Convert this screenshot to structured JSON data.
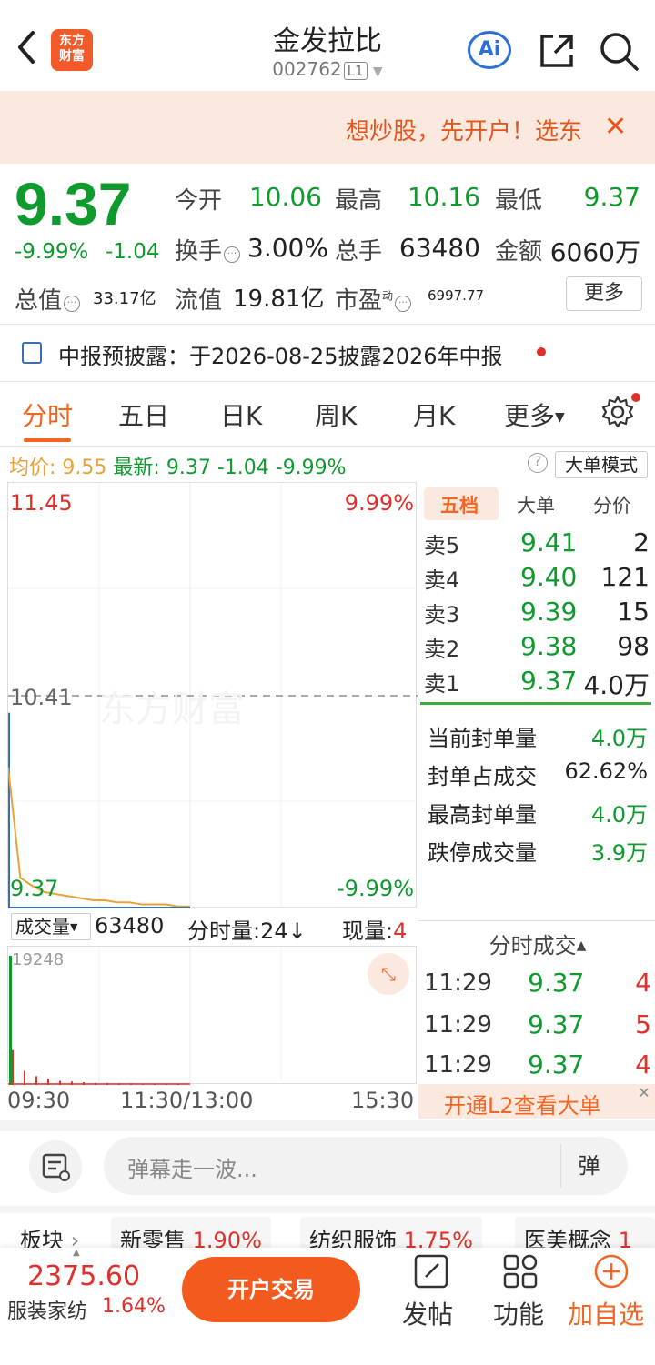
{
  "header": {
    "logo_text_line1": "东方",
    "logo_text_line2": "财富",
    "title": "金发拉比",
    "code": "002762",
    "level": "L1",
    "ai_label": "Ai"
  },
  "banner": {
    "text": "想炒股，先开户！选东"
  },
  "quote": {
    "price": "9.37",
    "pct": "-9.99%",
    "change": "-1.04",
    "fields": {
      "open_label": "今开",
      "open": "10.06",
      "high_label": "最高",
      "high": "10.16",
      "low_label": "最低",
      "low": "9.37",
      "turnover_label": "换手",
      "turnover": "3.00%",
      "volume_label": "总手",
      "volume": "63480",
      "amount_label": "金额",
      "amount": "6060万",
      "mktcap_label": "总值",
      "mktcap": "33.17亿",
      "float_label": "流值",
      "float": "19.81亿",
      "pe_label": "市盈",
      "pe_sup": "动",
      "pe": "6997.77"
    },
    "more_label": "更多"
  },
  "notice": {
    "text": "中报预披露：于2026-08-25披露2026年中报"
  },
  "tabs": [
    "分时",
    "五日",
    "日K",
    "周K",
    "月K",
    "更多"
  ],
  "avg_row": {
    "avg_label": "均价:",
    "avg": "9.55",
    "latest_label": "最新:",
    "latest": "9.37",
    "chg": "-1.04",
    "pct": "-9.99%",
    "help": "?",
    "bigorder_label": "大单模式"
  },
  "chart": {
    "top_price": "11.45",
    "top_pct": "9.99%",
    "mid_price": "10.41",
    "bottom_price": "9.37",
    "bottom_pct": "-9.99%",
    "watermark": "东方财富",
    "vol_max": "19248",
    "line_color": "#e8a23a",
    "up_color": "#e0302b",
    "down_color": "#0f9a2e"
  },
  "chart_data": {
    "type": "line",
    "title": "",
    "ylim": [
      9.37,
      11.45
    ],
    "series": [
      {
        "name": "",
        "values": [
          10.06,
          9.52,
          9.48,
          9.45,
          9.44,
          9.43,
          9.42,
          9.41,
          9.41,
          9.4,
          9.4,
          9.39,
          9.39,
          9.39,
          9.38,
          9.38
        ]
      }
    ],
    "volume": [
      19248,
      5200,
      2100,
      1300,
      900,
      600,
      500,
      400,
      300,
      300,
      250,
      250,
      200,
      200,
      180,
      160
    ]
  },
  "volume_row": {
    "label": "成交量",
    "total": "63480",
    "fen_label": "分时量:24↓",
    "now_label": "现量:",
    "now_value": "4"
  },
  "time_axis": [
    "09:30",
    "11:30/13:00",
    "15:30"
  ],
  "orderbook": {
    "tabs": [
      "五档",
      "大单",
      "分价"
    ],
    "asks": [
      {
        "label": "卖5",
        "price": "9.41",
        "vol": "2"
      },
      {
        "label": "卖4",
        "price": "9.40",
        "vol": "121"
      },
      {
        "label": "卖3",
        "price": "9.39",
        "vol": "15"
      },
      {
        "label": "卖2",
        "price": "9.38",
        "vol": "98"
      },
      {
        "label": "卖1",
        "price": "9.37",
        "vol": "4.0万"
      }
    ],
    "seal": [
      {
        "label": "当前封单量",
        "value": "4.0万"
      },
      {
        "label": "封单占成交",
        "value": "62.62%"
      },
      {
        "label": "最高封单量",
        "value": "4.0万"
      },
      {
        "label": "跌停成交量",
        "value": "3.9万"
      }
    ],
    "ticks_title": "分时成交",
    "ticks": [
      {
        "time": "11:29",
        "price": "9.37",
        "vol": "4"
      },
      {
        "time": "11:29",
        "price": "9.37",
        "vol": "5"
      },
      {
        "time": "11:29",
        "price": "9.37",
        "vol": "4"
      }
    ],
    "l2_text": "开通L2查看大单"
  },
  "danmu": {
    "placeholder": "弹幕走一波...",
    "btn": "弹"
  },
  "sectors": {
    "label": "板块",
    "items": [
      {
        "name": "新零售",
        "pct": "1.90%"
      },
      {
        "name": "纺织服饰",
        "pct": "1.75%"
      },
      {
        "name": "医美概念",
        "pct": "1"
      }
    ]
  },
  "bottom": {
    "index_value": "2375.60",
    "index_name": "服装家纺",
    "index_pct": "1.64%",
    "trade_btn": "开户交易",
    "post": "发帖",
    "func": "功能",
    "add": "加自选"
  }
}
